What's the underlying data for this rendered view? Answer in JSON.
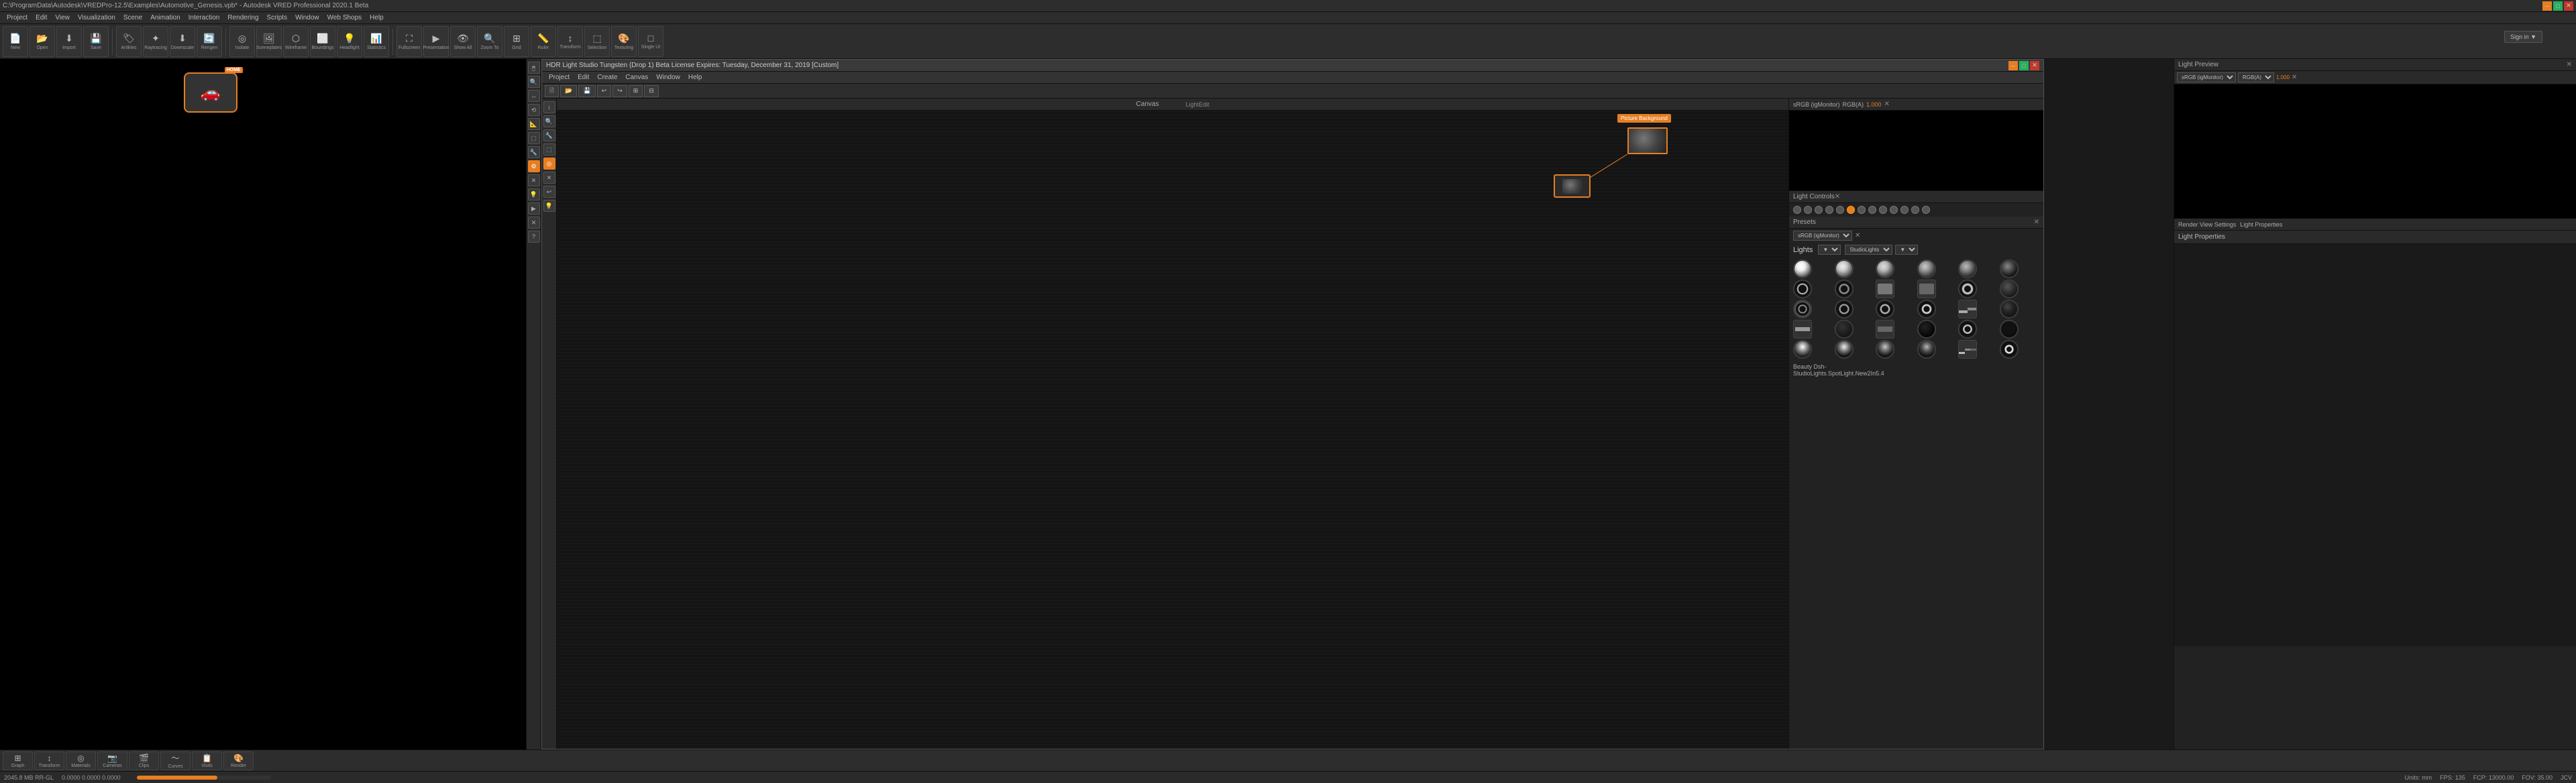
{
  "app": {
    "title": "C:\\ProgramData\\Autodesk\\VREDPro-12.5\\Examples\\Automotive_Genesis.vpb* - Autodesk VRED Professional 2020.1 Beta",
    "menus": [
      "Project",
      "Edit",
      "View",
      "Visualization",
      "Scene",
      "Animation",
      "Interaction",
      "Rendering",
      "Scripts",
      "Window",
      "Web Shops",
      "Help"
    ]
  },
  "toolbar": {
    "buttons": [
      {
        "label": "New",
        "icon": "📄"
      },
      {
        "label": "Open",
        "icon": "📂"
      },
      {
        "label": "Import",
        "icon": "⬇"
      },
      {
        "label": "Save",
        "icon": "💾"
      },
      {
        "label": "Artikles",
        "icon": "🏷"
      },
      {
        "label": "Raytracing",
        "icon": "✦"
      },
      {
        "label": "Downscale",
        "icon": "⬇"
      },
      {
        "label": "Rengen",
        "icon": "🔄"
      },
      {
        "label": "Isolate",
        "icon": "◎"
      },
      {
        "label": "Sceneplates",
        "icon": "🖼"
      },
      {
        "label": "Wireframe",
        "icon": "⬡"
      },
      {
        "label": "Boundings",
        "icon": "⬜"
      },
      {
        "label": "Headlight",
        "icon": "💡"
      },
      {
        "label": "Statistics",
        "icon": "📊"
      },
      {
        "label": "Fullscreen",
        "icon": "⛶"
      },
      {
        "label": "Presentation",
        "icon": "▶"
      },
      {
        "label": "Show All",
        "icon": "👁"
      },
      {
        "label": "Zoom To",
        "icon": "🔍"
      },
      {
        "label": "Grid",
        "icon": "⊞"
      },
      {
        "label": "Ruler",
        "icon": "📏"
      },
      {
        "label": "Transform",
        "icon": "↕"
      },
      {
        "label": "Selection",
        "icon": "⬚"
      },
      {
        "label": "Texturing",
        "icon": "🎨"
      },
      {
        "label": "Single UI",
        "icon": "□"
      }
    ],
    "sign_in": "Sign in ▼"
  },
  "sidebar_icons": [
    "🖱",
    "🔍",
    "↔",
    "⟲",
    "📐",
    "⬚",
    "🔧",
    "⚙",
    "✕",
    "💡",
    "▶",
    "✕",
    "❓"
  ],
  "hdr_window": {
    "title": "HDR Light Studio Tungsten (Drop 1) Beta License Expires: Tuesday, December 31, 2019 [Custom]",
    "menus": [
      "Project",
      "Edit",
      "Create",
      "Canvas",
      "Window",
      "Help"
    ],
    "canvas_label": "Canvas",
    "light_edit_label": "LightEdit",
    "light_preview_label": "Light Preview",
    "light_properties_label": "Light Properties",
    "render_view_settings": "Render View Settings",
    "light_controls_label": "Light Controls",
    "presets_label": "Presets",
    "color_space": "sRGB (igMonitor)",
    "rgb_label": "RGB(A)",
    "value": "1.000",
    "lights_label": "Lights",
    "studio_lights": "StudioLights",
    "beauty_dsh": "Beauty Dsh-",
    "studio_light_info": "StudioLights.SpotLight.New2In5.4"
  },
  "status_bar": {
    "memory": "2045.8 MB RR-GL",
    "coordinates": "0.0000 0.0000 0.0000",
    "units": "mm",
    "fps": "135",
    "fcp": "13000.00",
    "fov": "35.00",
    "mode": "JCV"
  },
  "bottom_toolbar": {
    "buttons": [
      {
        "label": "Graph",
        "icon": "⊞"
      },
      {
        "label": "Transform",
        "icon": "↕"
      },
      {
        "label": "Materials",
        "icon": "◎"
      },
      {
        "label": "Cameras",
        "icon": "📷"
      },
      {
        "label": "Clips",
        "icon": "🎬"
      },
      {
        "label": "Curves",
        "icon": "〜"
      },
      {
        "label": "Visits",
        "icon": "📋"
      },
      {
        "label": "Render",
        "icon": "🎨"
      }
    ]
  },
  "dot_controls": [
    "●",
    "●",
    "●",
    "●",
    "●",
    "●",
    "●",
    "●",
    "●",
    "●",
    "●",
    "●",
    "●"
  ],
  "light_thumbs": [
    {
      "type": "white-bright",
      "ring": false
    },
    {
      "type": "white-medium",
      "ring": false
    },
    {
      "type": "white-soft",
      "ring": false
    },
    {
      "type": "white-dim",
      "ring": false
    },
    {
      "type": "white-small",
      "ring": false
    },
    {
      "type": "dark",
      "ring": false
    },
    {
      "type": "dark-ring",
      "ring": true
    },
    {
      "type": "mixed",
      "ring": false
    },
    {
      "type": "square",
      "ring": false
    },
    {
      "type": "square2",
      "ring": false
    },
    {
      "type": "ring-large",
      "ring": true
    },
    {
      "type": "dark2",
      "ring": false
    },
    {
      "type": "ring2",
      "ring": true
    },
    {
      "type": "ring3",
      "ring": true
    },
    {
      "type": "ring4",
      "ring": true
    },
    {
      "type": "ring5",
      "ring": true
    },
    {
      "type": "strip",
      "ring": false
    },
    {
      "type": "dark3",
      "ring": false
    },
    {
      "type": "strip2",
      "ring": false
    },
    {
      "type": "dark4",
      "ring": false
    },
    {
      "type": "strip3",
      "ring": false
    },
    {
      "type": "dark5",
      "ring": false
    },
    {
      "type": "ring6",
      "ring": true
    },
    {
      "type": "dark6",
      "ring": false
    },
    {
      "type": "spot",
      "ring": false
    },
    {
      "type": "spot2",
      "ring": false
    },
    {
      "type": "spot3",
      "ring": false
    },
    {
      "type": "spot4",
      "ring": false
    },
    {
      "type": "strip4",
      "ring": false
    },
    {
      "type": "dark7",
      "ring": false
    }
  ]
}
